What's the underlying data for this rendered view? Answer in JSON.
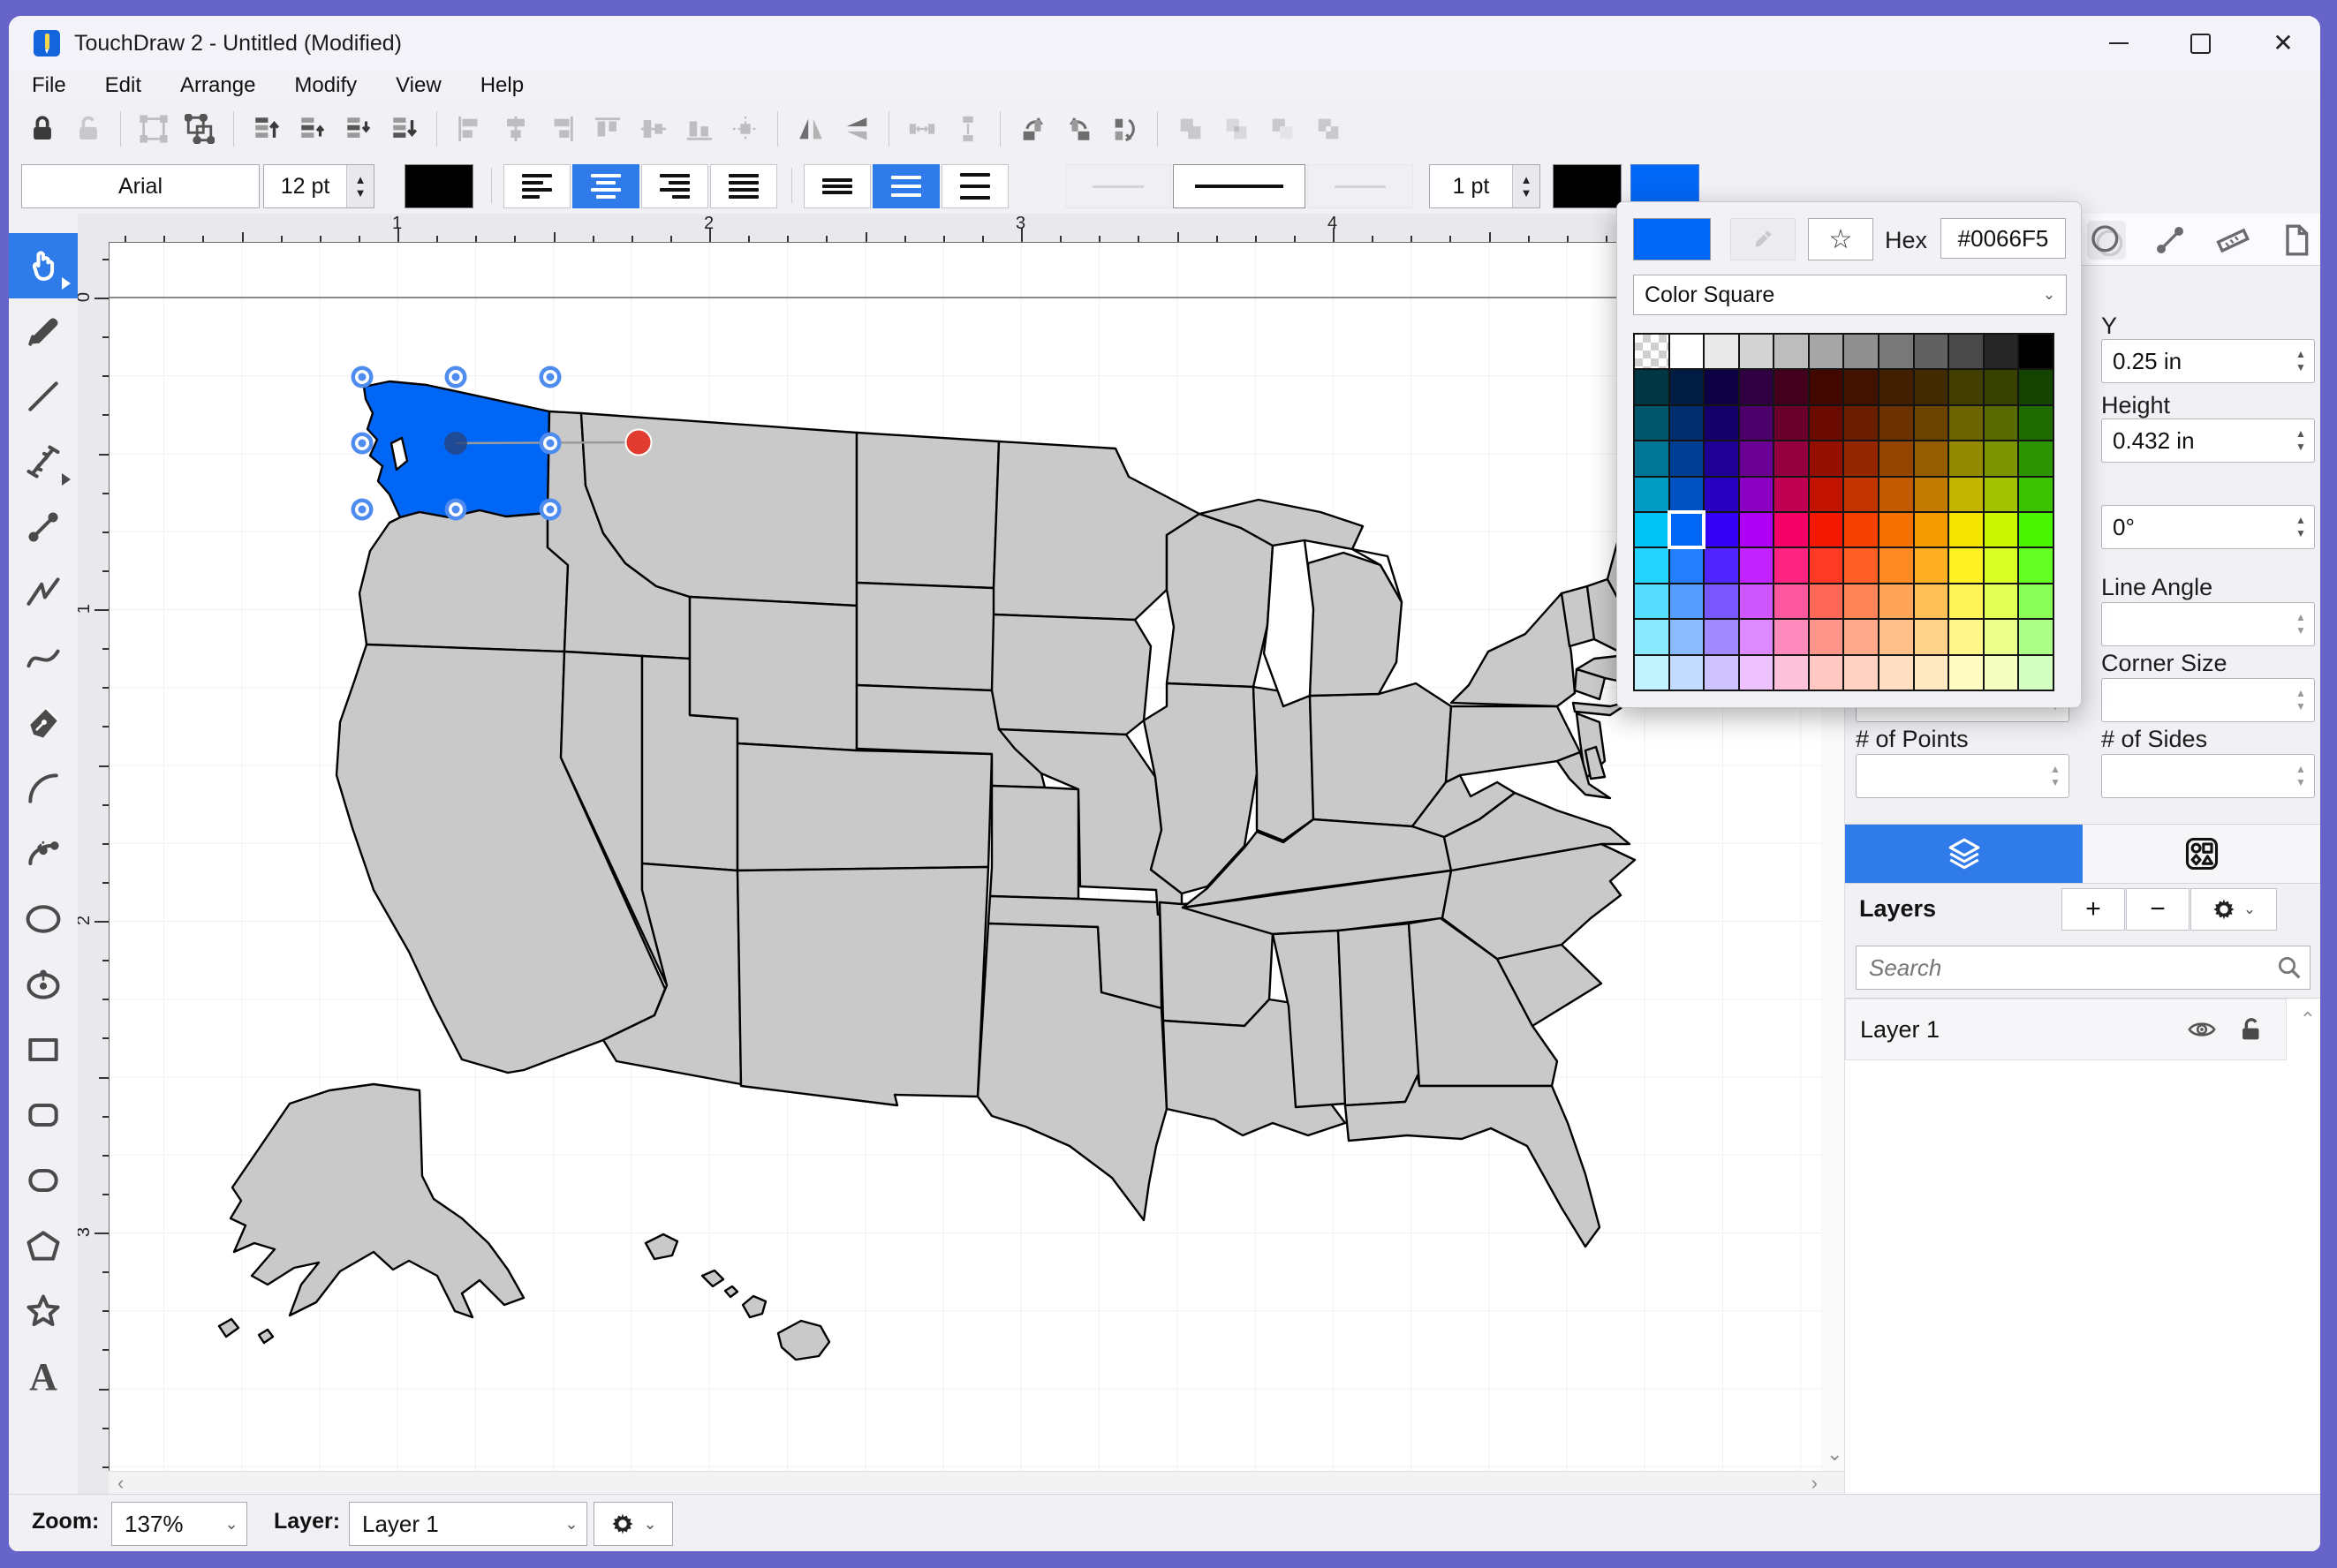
{
  "window": {
    "title": "TouchDraw 2 - Untitled (Modified)"
  },
  "menu": {
    "items": [
      "File",
      "Edit",
      "Arrange",
      "Modify",
      "View",
      "Help"
    ]
  },
  "toolbar_format": {
    "font": "Arial",
    "font_size": "12 pt",
    "stroke_width": "1 pt",
    "text_color": "#000000",
    "stroke_color": "#000000",
    "fill_color": "#0066F5"
  },
  "ruler": {
    "horizontal_numbers": [
      "1",
      "2",
      "3",
      "4"
    ],
    "vertical_numbers": [
      "0",
      "1",
      "2",
      "3"
    ]
  },
  "color_popup": {
    "hex_label": "Hex",
    "hex_value": "#0066F5",
    "mode": "Color Square",
    "saturation": 100,
    "hues": [
      192,
      215,
      252,
      283,
      335,
      6,
      16,
      28,
      38,
      56,
      70,
      102
    ],
    "lightness_rows": [
      13,
      21,
      29,
      38,
      48,
      57,
      67,
      77,
      88
    ],
    "grayscale_row": [
      "checker",
      "#ffffff",
      "#e9e9e9",
      "#d3d3d3",
      "#bdbdbd",
      "#a6a6a6",
      "#8f8f8f",
      "#787878",
      "#616161",
      "#494949",
      "#262626",
      "#000000"
    ],
    "selected_cell": {
      "row": 5,
      "col": 1
    }
  },
  "properties_panel": {
    "fields_right": [
      {
        "label": "Y",
        "value": "0.25 in"
      },
      {
        "label": "Height",
        "value": "0.432 in"
      },
      {
        "label": "",
        "value": "0°"
      },
      {
        "label": "Line Angle",
        "value": ""
      },
      {
        "label": "Corner Size",
        "value": ""
      },
      {
        "label": "# of Sides",
        "value": ""
      }
    ],
    "fields_left": [
      {
        "label": "# of Points",
        "value": ""
      }
    ]
  },
  "layers_panel": {
    "title": "Layers",
    "add_label": "+",
    "remove_label": "−",
    "search_placeholder": "Search",
    "layers": [
      {
        "name": "Layer 1",
        "visible": true,
        "locked": false
      }
    ]
  },
  "status_bar": {
    "zoom_label": "Zoom:",
    "zoom_value": "137%",
    "layer_label": "Layer:",
    "layer_value": "Layer 1"
  },
  "colors": {
    "desktop": "#6663C9",
    "accent_blue": "#2E7BE9",
    "selection_fill": "#0066F5",
    "map_gray": "#C9C9C9",
    "handle_blue": "#4F8CEF",
    "handle_red": "#E23B30"
  }
}
